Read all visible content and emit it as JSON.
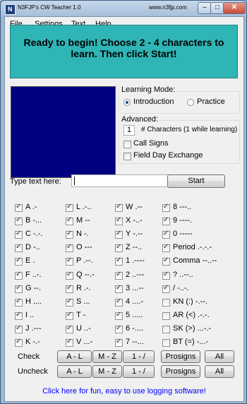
{
  "window": {
    "title": "N3FJP's CW Teacher 1.0",
    "url": "www.n3fjp.com",
    "app_icon_glyph": "N",
    "minimize_glyph": "–",
    "maximize_glyph": "□",
    "close_glyph": "✕"
  },
  "menu": [
    "File",
    "Settings",
    "Text",
    "Help"
  ],
  "banner": {
    "line1": "Ready to begin!  Choose 2 - 4 characters to",
    "line2": "learn.  Then click Start!",
    "bg_color": "#2fb5b5"
  },
  "display_panel_color": "#000080",
  "learning_mode": {
    "label": "Learning Mode:",
    "options": [
      {
        "label": "Introduction",
        "selected": true
      },
      {
        "label": "Practice",
        "selected": false
      }
    ]
  },
  "advanced": {
    "label": "Advanced:",
    "num_chars_value": "1",
    "num_chars_label": "# Characters (1 while learning)",
    "call_signs": {
      "label": "Call Signs",
      "checked": false
    },
    "field_day": {
      "label": "Field Day Exchange",
      "checked": false
    }
  },
  "type_text": {
    "label": "Type text here:",
    "value": ""
  },
  "start_button": "Start",
  "characters": [
    [
      {
        "label": "A .-",
        "checked": true
      },
      {
        "label": "B -...",
        "checked": true
      },
      {
        "label": "C -.-.",
        "checked": true
      },
      {
        "label": "D -..",
        "checked": true
      },
      {
        "label": "E .",
        "checked": true
      },
      {
        "label": "F ..-.",
        "checked": true
      },
      {
        "label": "G --.",
        "checked": true
      },
      {
        "label": "H ....",
        "checked": true
      },
      {
        "label": "I ..",
        "checked": true
      },
      {
        "label": "J .---",
        "checked": true
      },
      {
        "label": "K -.-",
        "checked": true
      }
    ],
    [
      {
        "label": "L .-..",
        "checked": true
      },
      {
        "label": "M --",
        "checked": true
      },
      {
        "label": "N -.",
        "checked": true
      },
      {
        "label": "O ---",
        "checked": true
      },
      {
        "label": "P .--.",
        "checked": true
      },
      {
        "label": "Q --.-",
        "checked": true
      },
      {
        "label": "R .-.",
        "checked": true
      },
      {
        "label": "S ...",
        "checked": true
      },
      {
        "label": "T -",
        "checked": true
      },
      {
        "label": "U ..-",
        "checked": true
      },
      {
        "label": "V ...-",
        "checked": true
      }
    ],
    [
      {
        "label": "W .--",
        "checked": true
      },
      {
        "label": "X -..-",
        "checked": true
      },
      {
        "label": "Y -.--",
        "checked": true
      },
      {
        "label": "Z --..",
        "checked": true
      },
      {
        "label": "1 .----",
        "checked": true
      },
      {
        "label": "2 ..---",
        "checked": true
      },
      {
        "label": "3 ...--",
        "checked": true
      },
      {
        "label": "4 ....-",
        "checked": true
      },
      {
        "label": "5 .....",
        "checked": true
      },
      {
        "label": "6 -....",
        "checked": true
      },
      {
        "label": "7 --...",
        "checked": true
      }
    ],
    [
      {
        "label": "8 ---..",
        "checked": true
      },
      {
        "label": "9 ----.",
        "checked": true
      },
      {
        "label": "0 -----",
        "checked": true
      },
      {
        "label": "Period .-.-.-",
        "checked": true
      },
      {
        "label": "Comma --..--",
        "checked": true
      },
      {
        "label": "? ..--..",
        "checked": true
      },
      {
        "label": "/ -..-.",
        "checked": true
      },
      {
        "label": "KN (:) -.--.",
        "checked": false
      },
      {
        "label": "AR (<) .-.-.",
        "checked": false
      },
      {
        "label": "SK (>) ...-.-",
        "checked": false
      },
      {
        "label": "BT (=) -...-",
        "checked": false
      }
    ]
  ],
  "check_row": {
    "label": "Check",
    "buttons": [
      "A - L",
      "M - Z",
      "1 - /",
      "Prosigns",
      "All"
    ]
  },
  "uncheck_row": {
    "label": "Uncheck",
    "buttons": [
      "A - L",
      "M - Z",
      "1 - /",
      "Prosigns",
      "All"
    ]
  },
  "footer_link": "Click here for fun, easy to use logging software!"
}
